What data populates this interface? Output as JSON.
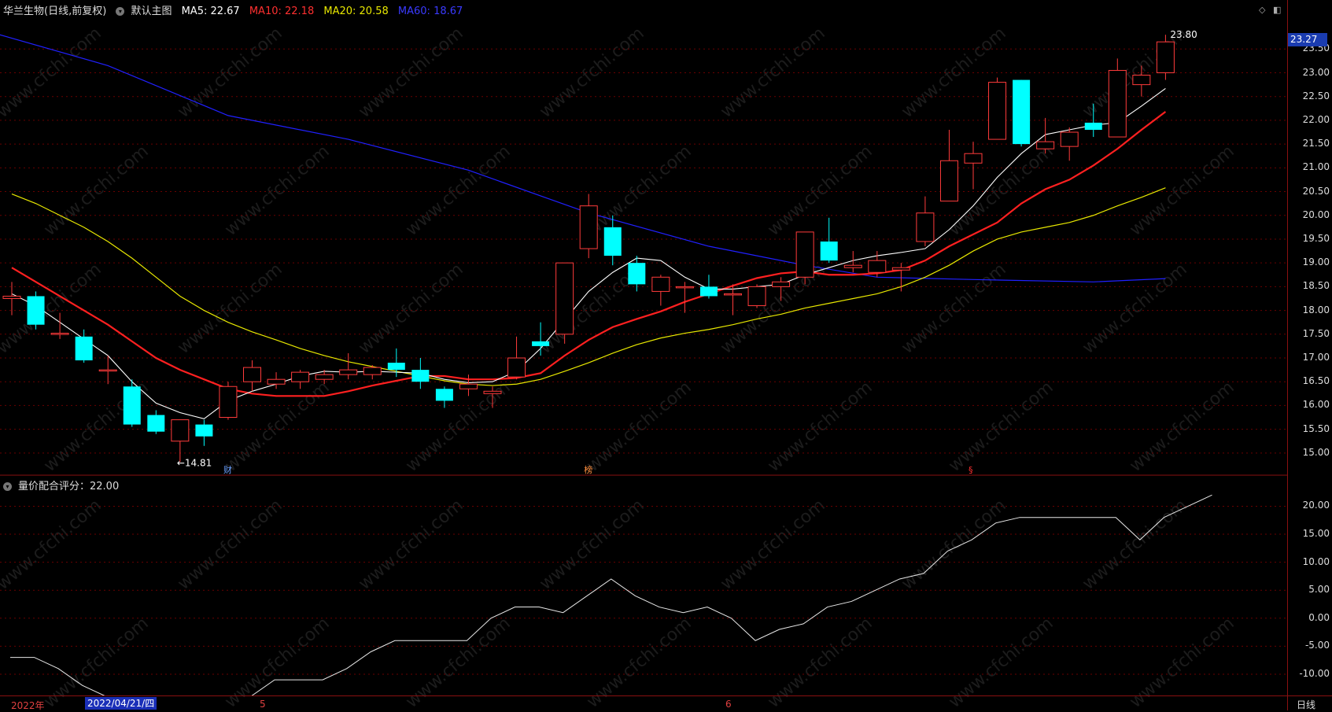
{
  "stock": {
    "name": "华兰生物",
    "mode": "(日线,前复权)",
    "main_label": "默认主图"
  },
  "ma_legend": [
    {
      "label": "MA5: 22.67",
      "color": "#ffffff"
    },
    {
      "label": "MA10: 22.18",
      "color": "#ff2222"
    },
    {
      "label": "MA20: 20.58",
      "color": "#e8e800"
    },
    {
      "label": "MA60: 18.67",
      "color": "#2222ff"
    }
  ],
  "indicator": {
    "label": "量价配合评分：22.00"
  },
  "current_price": "23.27",
  "annotations": {
    "high": "23.80",
    "low": "←14.81"
  },
  "events": [
    {
      "label": "财",
      "color": "#6aa0ff",
      "index": 9
    },
    {
      "label": "榜",
      "color": "#ff9040",
      "index": 24
    },
    {
      "label": "§",
      "color": "#ff3030",
      "index": 40
    }
  ],
  "bottom_bar": {
    "year": "2022年",
    "cursor_date": "2022/04/21/四",
    "month5": "5",
    "month6": "6",
    "period_button": "日线"
  },
  "watermark": "www.cfchi.com",
  "colors": {
    "up": "#ff3b3b",
    "down": "#00ffff",
    "ma5": "#ffffff",
    "ma10": "#ff2020",
    "ma20": "#e8e800",
    "ma60": "#2020ff",
    "grid": "#6a0000"
  },
  "chart_data": {
    "type": "candlestick",
    "price_axis": {
      "ticks": [
        "23.50",
        "23.00",
        "22.50",
        "22.00",
        "21.50",
        "21.00",
        "20.50",
        "20.00",
        "19.50",
        "19.00",
        "18.50",
        "18.00",
        "17.50",
        "17.00",
        "16.50",
        "16.00",
        "15.50",
        "15.00"
      ],
      "range": [
        14.6,
        24.2
      ]
    },
    "candles": [
      {
        "o": 18.25,
        "c": 18.3,
        "h": 18.6,
        "l": 17.9
      },
      {
        "o": 18.3,
        "c": 17.7,
        "h": 18.4,
        "l": 17.6
      },
      {
        "o": 17.52,
        "c": 17.52,
        "h": 17.95,
        "l": 17.4
      },
      {
        "o": 17.45,
        "c": 16.95,
        "h": 17.6,
        "l": 16.9
      },
      {
        "o": 16.75,
        "c": 16.75,
        "h": 17.05,
        "l": 16.45
      },
      {
        "o": 16.4,
        "c": 15.6,
        "h": 16.55,
        "l": 15.55
      },
      {
        "o": 15.8,
        "c": 15.45,
        "h": 15.9,
        "l": 15.4
      },
      {
        "o": 15.25,
        "c": 15.7,
        "h": 15.7,
        "l": 14.81
      },
      {
        "o": 15.6,
        "c": 15.35,
        "h": 15.7,
        "l": 15.15
      },
      {
        "o": 15.75,
        "c": 16.4,
        "h": 16.5,
        "l": 15.7
      },
      {
        "o": 16.5,
        "c": 16.8,
        "h": 16.95,
        "l": 16.3
      },
      {
        "o": 16.45,
        "c": 16.55,
        "h": 16.7,
        "l": 16.35
      },
      {
        "o": 16.5,
        "c": 16.7,
        "h": 16.75,
        "l": 16.35
      },
      {
        "o": 16.55,
        "c": 16.65,
        "h": 16.75,
        "l": 16.45
      },
      {
        "o": 16.65,
        "c": 16.75,
        "h": 17.1,
        "l": 16.55
      },
      {
        "o": 16.65,
        "c": 16.8,
        "h": 16.85,
        "l": 16.55
      },
      {
        "o": 16.9,
        "c": 16.75,
        "h": 17.2,
        "l": 16.6
      },
      {
        "o": 16.75,
        "c": 16.5,
        "h": 17.0,
        "l": 16.35
      },
      {
        "o": 16.35,
        "c": 16.1,
        "h": 16.4,
        "l": 15.95
      },
      {
        "o": 16.35,
        "c": 16.45,
        "h": 16.65,
        "l": 16.2
      },
      {
        "o": 16.25,
        "c": 16.3,
        "h": 16.4,
        "l": 15.95
      },
      {
        "o": 16.6,
        "c": 17.0,
        "h": 17.45,
        "l": 16.55
      },
      {
        "o": 17.35,
        "c": 17.25,
        "h": 17.75,
        "l": 17.05
      },
      {
        "o": 17.5,
        "c": 19.0,
        "h": 19.0,
        "l": 17.3
      },
      {
        "o": 19.3,
        "c": 20.2,
        "h": 20.45,
        "l": 19.1
      },
      {
        "o": 19.75,
        "c": 19.15,
        "h": 20.0,
        "l": 18.95
      },
      {
        "o": 19.0,
        "c": 18.55,
        "h": 19.15,
        "l": 18.4
      },
      {
        "o": 18.4,
        "c": 18.7,
        "h": 18.75,
        "l": 18.1
      },
      {
        "o": 18.5,
        "c": 18.5,
        "h": 18.6,
        "l": 17.95
      },
      {
        "o": 18.5,
        "c": 18.3,
        "h": 18.75,
        "l": 18.25
      },
      {
        "o": 18.35,
        "c": 18.35,
        "h": 18.55,
        "l": 17.9
      },
      {
        "o": 18.1,
        "c": 18.5,
        "h": 18.55,
        "l": 18.05
      },
      {
        "o": 18.5,
        "c": 18.6,
        "h": 18.7,
        "l": 18.2
      },
      {
        "o": 18.7,
        "c": 19.65,
        "h": 19.65,
        "l": 18.55
      },
      {
        "o": 19.45,
        "c": 19.05,
        "h": 19.95,
        "l": 19.0
      },
      {
        "o": 18.9,
        "c": 18.95,
        "h": 19.25,
        "l": 18.8
      },
      {
        "o": 18.8,
        "c": 19.05,
        "h": 19.25,
        "l": 18.7
      },
      {
        "o": 18.85,
        "c": 18.9,
        "h": 19.0,
        "l": 18.4
      },
      {
        "o": 19.45,
        "c": 20.05,
        "h": 20.4,
        "l": 19.35
      },
      {
        "o": 20.3,
        "c": 21.15,
        "h": 21.8,
        "l": 20.3
      },
      {
        "o": 21.1,
        "c": 21.3,
        "h": 21.55,
        "l": 20.55
      },
      {
        "o": 21.6,
        "c": 22.8,
        "h": 22.9,
        "l": 21.6
      },
      {
        "o": 22.85,
        "c": 21.5,
        "h": 22.85,
        "l": 21.45
      },
      {
        "o": 21.4,
        "c": 21.55,
        "h": 22.05,
        "l": 21.3
      },
      {
        "o": 21.45,
        "c": 21.75,
        "h": 21.85,
        "l": 21.15
      },
      {
        "o": 21.95,
        "c": 21.8,
        "h": 22.35,
        "l": 21.65
      },
      {
        "o": 21.65,
        "c": 23.05,
        "h": 23.3,
        "l": 21.65
      },
      {
        "o": 22.75,
        "c": 22.95,
        "h": 23.15,
        "l": 22.5
      },
      {
        "o": 23.0,
        "c": 23.65,
        "h": 23.8,
        "l": 22.85
      }
    ],
    "ma5": [
      18.35,
      18.1,
      17.75,
      17.4,
      17.05,
      16.5,
      16.05,
      15.85,
      15.72,
      16.1,
      16.3,
      16.45,
      16.62,
      16.72,
      16.7,
      16.72,
      16.7,
      16.68,
      16.55,
      16.48,
      16.5,
      16.72,
      17.2,
      17.8,
      18.4,
      18.8,
      19.1,
      19.05,
      18.7,
      18.45,
      18.45,
      18.5,
      18.55,
      18.75,
      18.9,
      19.05,
      19.15,
      19.22,
      19.3,
      19.7,
      20.2,
      20.8,
      21.3,
      21.7,
      21.8,
      21.9,
      21.95,
      22.3,
      22.67
    ],
    "ma10": [
      18.9,
      18.6,
      18.3,
      18.0,
      17.7,
      17.35,
      17.0,
      16.75,
      16.55,
      16.35,
      16.25,
      16.2,
      16.2,
      16.2,
      16.3,
      16.42,
      16.52,
      16.62,
      16.62,
      16.55,
      16.55,
      16.58,
      16.68,
      17.05,
      17.38,
      17.65,
      17.82,
      17.98,
      18.18,
      18.35,
      18.52,
      18.68,
      18.78,
      18.82,
      18.75,
      18.75,
      18.78,
      18.85,
      19.05,
      19.35,
      19.6,
      19.85,
      20.25,
      20.55,
      20.75,
      21.05,
      21.4,
      21.8,
      22.18
    ],
    "ma20": [
      20.45,
      20.25,
      20.0,
      19.75,
      19.45,
      19.1,
      18.7,
      18.3,
      18.0,
      17.75,
      17.55,
      17.38,
      17.2,
      17.05,
      16.92,
      16.82,
      16.72,
      16.62,
      16.52,
      16.45,
      16.42,
      16.45,
      16.55,
      16.72,
      16.9,
      17.1,
      17.28,
      17.42,
      17.52,
      17.6,
      17.7,
      17.82,
      17.92,
      18.05,
      18.15,
      18.25,
      18.35,
      18.5,
      18.7,
      18.95,
      19.25,
      19.5,
      19.65,
      19.75,
      19.85,
      20.0,
      20.2,
      20.38,
      20.58
    ],
    "ma60_points": [
      [
        -0.5,
        23.8
      ],
      [
        4,
        23.15
      ],
      [
        9,
        22.1
      ],
      [
        14,
        21.6
      ],
      [
        19,
        20.95
      ],
      [
        24,
        20.05
      ],
      [
        29,
        19.35
      ],
      [
        33,
        18.95
      ],
      [
        36,
        18.7
      ],
      [
        40,
        18.65
      ],
      [
        45,
        18.6
      ],
      [
        48,
        18.67
      ]
    ],
    "score_axis": {
      "ticks": [
        "20.00",
        "15.00",
        "10.00",
        "5.00",
        "0.00",
        "-5.00",
        "-10.00"
      ],
      "range": [
        -13.8,
        24.0
      ]
    },
    "score": [
      -7,
      -7,
      -9,
      -12,
      -14,
      -18,
      -18,
      -18,
      -17,
      -15,
      -14,
      -11,
      -11,
      -11,
      -9,
      -6,
      -4,
      -4,
      -4,
      -4,
      0,
      2,
      2,
      1,
      4,
      7,
      4,
      2,
      1,
      2,
      0,
      -4,
      -2,
      -1,
      2,
      3,
      5,
      7,
      8,
      12,
      14,
      17,
      18,
      18,
      18,
      18,
      18,
      14,
      18,
      20,
      22
    ]
  }
}
